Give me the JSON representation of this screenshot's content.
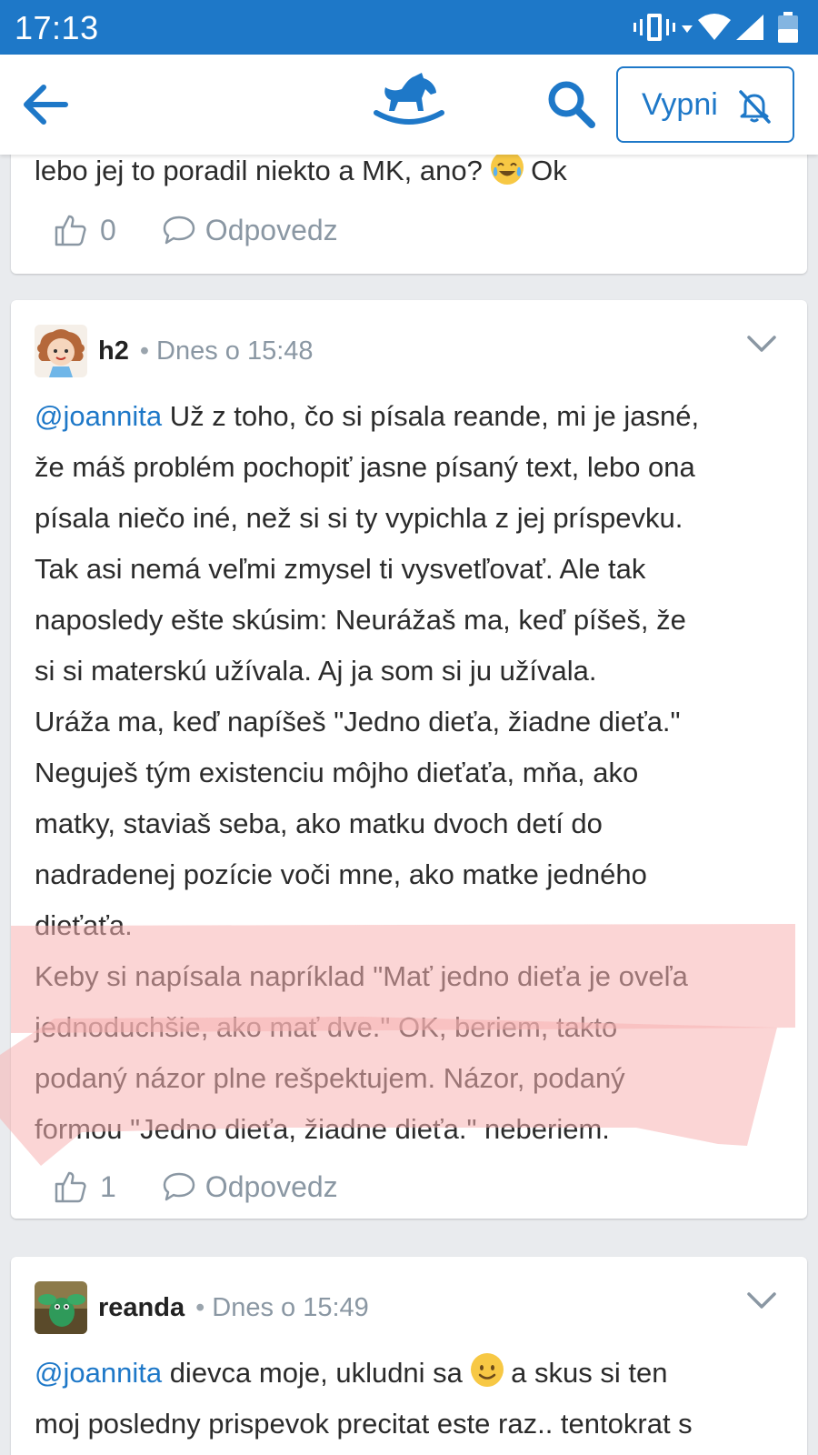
{
  "status_bar": {
    "time": "17:13"
  },
  "app_bar": {
    "mute_label": "Vypni",
    "icons": [
      "back-arrow-icon",
      "rocking-horse-logo-icon",
      "search-icon",
      "bell-off-icon"
    ]
  },
  "colors": {
    "brand": "#1e78c8",
    "muted": "#8a97a3",
    "highlight": "#f7b3b3"
  },
  "posts": [
    {
      "text_tail": "lebo jej to poradil niekto a MK, ano?",
      "text_after_emoji": "Ok",
      "emoji": "face-with-tears-of-joy",
      "likes": "0",
      "reply_label": "Odpovedz"
    },
    {
      "author": "h2",
      "separator": "•",
      "timestamp": "Dnes o 15:48",
      "mention": "@joannita",
      "lines": [
        "Už z toho, čo si písala reande, mi je jasné,",
        "že máš problém pochopiť jasne písaný text, lebo ona",
        "písala niečo iné, než si si ty vypichla z jej príspevku.",
        "Tak asi nemá veľmi zmysel ti vysvetľovať. Ale tak",
        "naposledy ešte skúsim: Neurážaš ma, keď píšeš, že",
        "si si materskú užívala. Aj ja som si ju užívala.",
        "Uráža ma, keď napíšeš \"Jedno dieťa, žiadne dieťa.\"",
        "Neguješ tým existenciu môjho dieťaťa, mňa, ako",
        "matky, staviaš seba, ako matku dvoch detí do",
        "nadradenej pozície voči mne, ako matke jedného",
        "dieťaťa.",
        "Keby si napísala napríklad \"Mať jedno dieťa je oveľa",
        "jednoduchšie, ako mať dve.\" OK, beriem, takto",
        "podaný názor plne rešpektujem. Názor, podaný",
        "formou \"Jedno dieťa, žiadne dieťa.\" neberiem."
      ],
      "likes": "1",
      "reply_label": "Odpovedz"
    },
    {
      "author": "reanda",
      "separator": "•",
      "timestamp": "Dnes o 15:49",
      "mention": "@joannita",
      "line1_before_emoji": "dievca moje, ukludni sa",
      "emoji": "slightly-smiling-face",
      "line1_after_emoji": "a skus si ten",
      "line2": "moj posledny prispevok precitat este raz.. tentokrat s"
    }
  ]
}
